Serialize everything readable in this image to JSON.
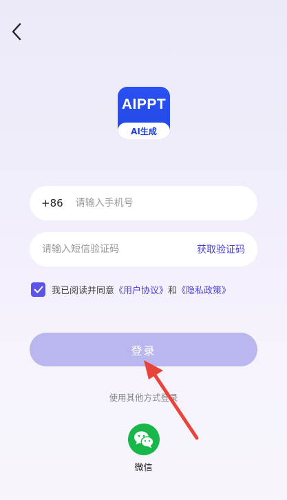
{
  "header": {
    "back_icon": "chevron-left-icon"
  },
  "logo": {
    "top_text": "AIPPT",
    "bottom_text": "AI生成"
  },
  "phone": {
    "country_code": "+86",
    "placeholder": "请输入手机号",
    "value": ""
  },
  "code": {
    "placeholder": "请输入短信验证码",
    "value": "",
    "get_code_label": "获取验证码"
  },
  "agreement": {
    "checked": true,
    "prefix": "我已阅读并同意",
    "user_agreement": "《用户协议》",
    "and": "和",
    "privacy_policy": "《隐私政策》"
  },
  "login": {
    "label": "登录"
  },
  "other_login": {
    "label": "使用其他方式登录",
    "wechat_label": "微信",
    "wechat_icon": "wechat-icon"
  },
  "colors": {
    "accent": "#4a3fd6",
    "checkbox": "#5b54e6",
    "login_button": "#bab7ef",
    "logo_blue": "#2248e6",
    "wechat_green": "#19b64a",
    "annotation_arrow": "#e8443a"
  }
}
